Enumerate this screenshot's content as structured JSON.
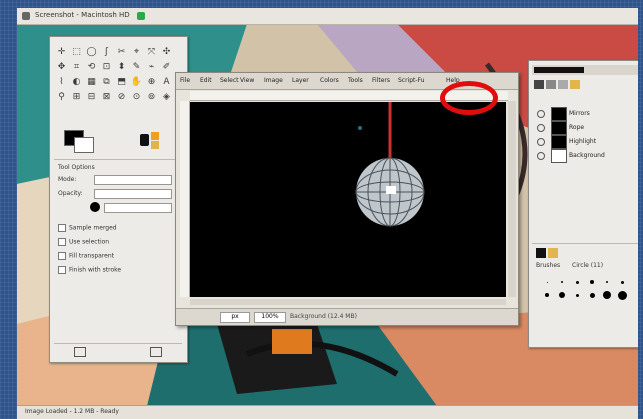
{
  "screen": {
    "window_title": "Screenshot - Macintosh HD",
    "status_line": "Image Loaded - 1.2 MB - Ready"
  },
  "toolbox": {
    "tools": [
      "✛",
      "⬚",
      "◯",
      "ʃ",
      "✂",
      "⌖",
      "⤧",
      "✣",
      "✥",
      "⌗",
      "⟲",
      "⊡",
      "⬍",
      "✎",
      "⌁",
      "✐",
      "⌇",
      "◐",
      "▦",
      "⧉",
      "⬒",
      "✋",
      "⊕",
      "A",
      "⚲",
      "⊞",
      "⊟",
      "⊠",
      "⊘",
      "⊙",
      "⊚",
      "◈"
    ],
    "options_title": "Tool Options",
    "option_mode": "Mode:",
    "option_opacity": "Opacity:",
    "checkboxes": [
      "Sample merged",
      "Use selection",
      "Fill transparent",
      "Finish with stroke"
    ]
  },
  "image_window": {
    "menus": [
      "File",
      "Edit",
      "Select",
      "View",
      "Image",
      "Layer",
      "Colors",
      "Tools",
      "Filters",
      "Script-Fu",
      "Help"
    ],
    "unit": "px",
    "zoom": "100%",
    "status": "Background (12.4 MB)"
  },
  "layers": {
    "items": [
      {
        "name": "Mirrors"
      },
      {
        "name": "Rope"
      },
      {
        "name": "Highlight"
      },
      {
        "name": "Background"
      }
    ],
    "brushes_title": "Brushes",
    "brush_label": "Circle (11)"
  },
  "colors": {
    "highlight": "#e10d0d",
    "canvas": "#000000",
    "rope": "#c8322f"
  }
}
